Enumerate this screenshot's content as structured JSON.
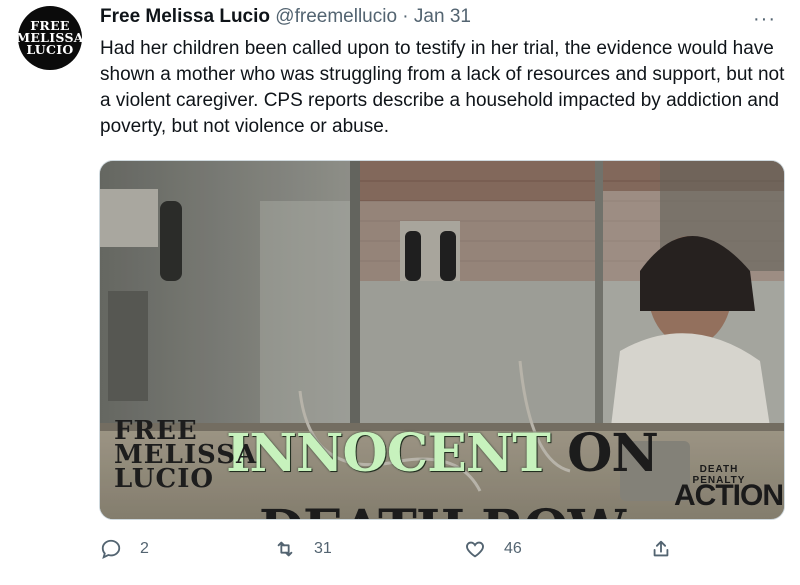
{
  "avatar": {
    "lines": [
      "FREE",
      "MELISSA",
      "LUCIO"
    ]
  },
  "tweet": {
    "author_name": "Free Melissa Lucio",
    "handle": "@freemellucio",
    "separator": "·",
    "date": "Jan 31",
    "more": "···",
    "text": "Had her children been called upon to testify in her trial, the evidence would have shown a mother who was struggling from a lack of resources and support, but not a violent caregiver. CPS reports describe a household impacted by addiction and poverty, but not violence or abuse."
  },
  "media": {
    "headline_part1": "INNOCENT",
    "headline_part2": "ON",
    "headline_line2": "DEATH ROW",
    "logo_lines": [
      "FREE",
      "MELISSA",
      "LUCIO"
    ],
    "dpa_small": "DEATH PENALTY",
    "dpa_big": "ACTION"
  },
  "actions": {
    "replies": "2",
    "retweets": "31",
    "likes": "46"
  },
  "colors": {
    "headline_green": "#c7f2bd",
    "muted": "#536471",
    "text": "#0f1419"
  }
}
